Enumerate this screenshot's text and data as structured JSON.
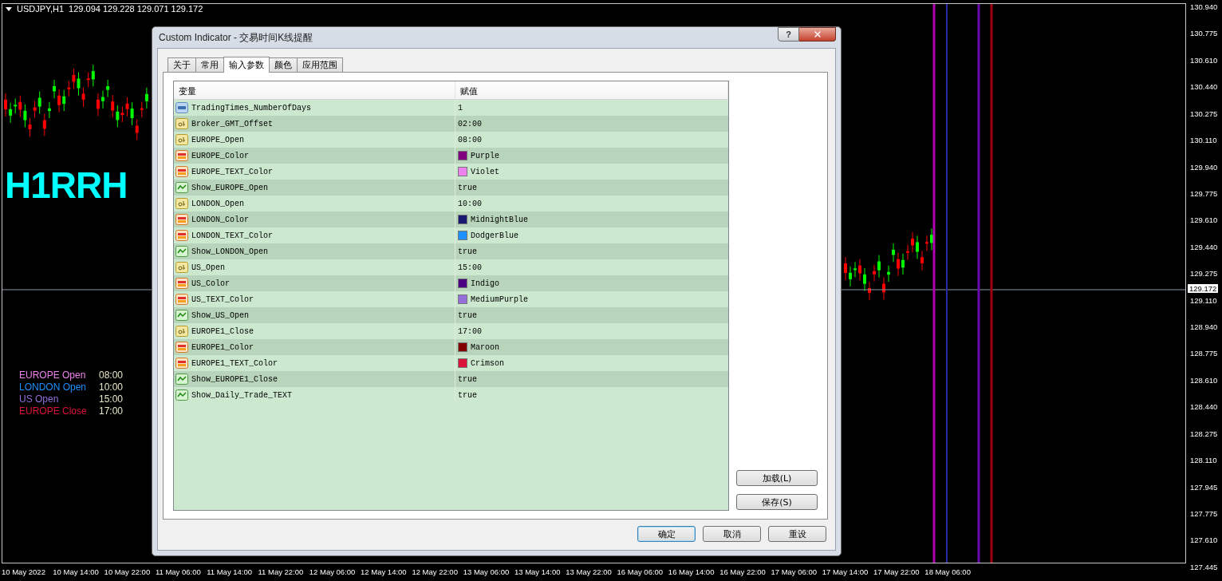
{
  "chart": {
    "symbol": "USDJPY,H1",
    "ohlc": "129.094 129.228 129.071 129.172",
    "label": "H1RRH",
    "legend": [
      {
        "label": "EUROPE Open",
        "time": "08:00",
        "color": "#ee82ee"
      },
      {
        "label": "LONDON Open",
        "time": "10:00",
        "color": "#1e90ff"
      },
      {
        "label": "US Open",
        "time": "15:00",
        "color": "#9370db"
      },
      {
        "label": "EUROPE Close",
        "time": "17:00",
        "color": "#dc143c"
      }
    ],
    "price_axis": [
      "130.940",
      "130.775",
      "130.610",
      "130.440",
      "130.275",
      "130.110",
      "129.940",
      "129.775",
      "129.610",
      "129.440",
      "129.275",
      "129.110",
      "128.940",
      "128.775",
      "128.610",
      "128.440",
      "128.275",
      "128.110",
      "127.945",
      "127.775",
      "127.610",
      "127.445"
    ],
    "current_price": "129.172",
    "time_axis": [
      "10 May 2022",
      "10 May 14:00",
      "10 May 22:00",
      "11 May 06:00",
      "11 May 14:00",
      "11 May 22:00",
      "12 May 06:00",
      "12 May 14:00",
      "12 May 22:00",
      "13 May 06:00",
      "13 May 14:00",
      "13 May 22:00",
      "16 May 06:00",
      "16 May 14:00",
      "16 May 22:00",
      "17 May 06:00",
      "17 May 14:00",
      "17 May 22:00",
      "18 May 06:00"
    ]
  },
  "dialog": {
    "title": "Custom Indicator - 交易时间K线提醒",
    "help_button": "?",
    "tabs": [
      {
        "label": "关于",
        "selected": false
      },
      {
        "label": "常用",
        "selected": false
      },
      {
        "label": "输入参数",
        "selected": true
      },
      {
        "label": "颜色",
        "selected": false
      },
      {
        "label": "应用范围",
        "selected": false
      }
    ],
    "table": {
      "columns": [
        "变量",
        "赋值"
      ],
      "rows": [
        {
          "kind": "int",
          "name": "TradingTimes_NumberOfDays",
          "value": "1"
        },
        {
          "kind": "string",
          "name": "Broker_GMT_Offset",
          "value": "02:00"
        },
        {
          "kind": "string",
          "name": "EUROPE_Open",
          "value": "08:00"
        },
        {
          "kind": "color",
          "name": "EUROPE_Color",
          "value": "Purple",
          "color": "#800080"
        },
        {
          "kind": "color",
          "name": "EUROPE_TEXT_Color",
          "value": "Violet",
          "color": "#ee82ee"
        },
        {
          "kind": "bool",
          "name": "Show_EUROPE_Open",
          "value": "true"
        },
        {
          "kind": "string",
          "name": "LONDON_Open",
          "value": "10:00"
        },
        {
          "kind": "color",
          "name": "LONDON_Color",
          "value": "MidnightBlue",
          "color": "#191970"
        },
        {
          "kind": "color",
          "name": "LONDON_TEXT_Color",
          "value": "DodgerBlue",
          "color": "#1e90ff"
        },
        {
          "kind": "bool",
          "name": "Show_LONDON_Open",
          "value": "true"
        },
        {
          "kind": "string",
          "name": "US_Open",
          "value": "15:00"
        },
        {
          "kind": "color",
          "name": "US_Color",
          "value": "Indigo",
          "color": "#4b0082"
        },
        {
          "kind": "color",
          "name": "US_TEXT_Color",
          "value": "MediumPurple",
          "color": "#9370db"
        },
        {
          "kind": "bool",
          "name": "Show_US_Open",
          "value": "true"
        },
        {
          "kind": "string",
          "name": "EUROPE1_Close",
          "value": "17:00"
        },
        {
          "kind": "color",
          "name": "EUROPE1_Color",
          "value": "Maroon",
          "color": "#800000"
        },
        {
          "kind": "color",
          "name": "EUROPE1_TEXT_Color",
          "value": "Crimson",
          "color": "#dc143c"
        },
        {
          "kind": "bool",
          "name": "Show_EUROPE1_Close",
          "value": "true"
        },
        {
          "kind": "bool",
          "name": "Show_Daily_Trade_TEXT",
          "value": "true"
        }
      ]
    },
    "side_buttons": [
      "加载(L)",
      "保存(S)"
    ],
    "buttons": [
      "确定",
      "取消",
      "重设"
    ]
  }
}
